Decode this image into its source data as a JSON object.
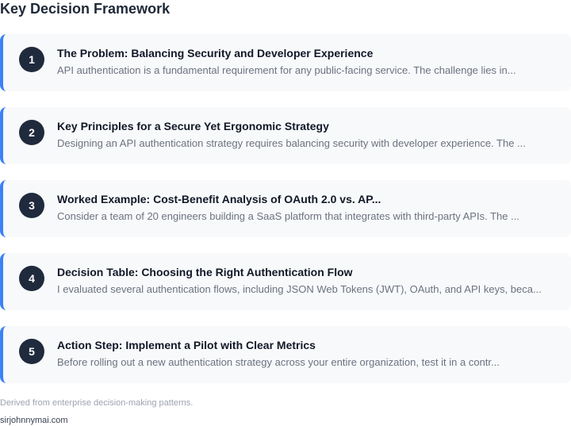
{
  "header": {
    "title": "Key Decision Framework"
  },
  "steps": [
    {
      "number": "1",
      "title": "The Problem: Balancing Security and Developer Experience",
      "description": "API authentication is a fundamental requirement for any public-facing service. The challenge lies in..."
    },
    {
      "number": "2",
      "title": "Key Principles for a Secure Yet Ergonomic Strategy",
      "description": "Designing an API authentication strategy requires balancing security with developer experience. The ..."
    },
    {
      "number": "3",
      "title": "Worked Example: Cost-Benefit Analysis of OAuth 2.0 vs. AP...",
      "description": "Consider a team of 20 engineers building a SaaS platform that integrates with third-party APIs. The ..."
    },
    {
      "number": "4",
      "title": "Decision Table: Choosing the Right Authentication Flow",
      "description": "I evaluated several authentication flows, including JSON Web Tokens (JWT), OAuth, and API keys, beca..."
    },
    {
      "number": "5",
      "title": "Action Step: Implement a Pilot with Clear Metrics",
      "description": "Before rolling out a new authentication strategy across your entire organization, test it in a contr..."
    }
  ],
  "footer": {
    "note": "Derived from enterprise decision-making patterns.",
    "site": "sirjohnnymai.com"
  },
  "colors": {
    "accent": "#3b82f6",
    "badge": "#1f2a3d",
    "card_background": "#f8f9fb"
  }
}
